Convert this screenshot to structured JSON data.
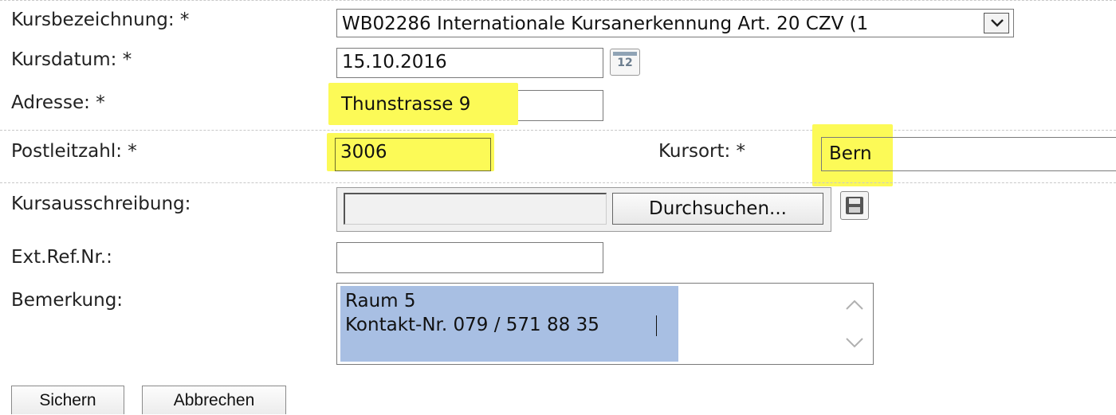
{
  "form": {
    "course_label": "Kursbezeichnung: *",
    "course_value": "WB02286 Internationale Kursanerkennung Art. 20 CZV (1",
    "date_label": "Kursdatum: *",
    "date_value": "15.10.2016",
    "calendar_icon_text": "12",
    "address_label": "Adresse: *",
    "address_value": "Thunstrasse 9",
    "zip_label": "Postleitzahl: *",
    "zip_value": "3006",
    "place_label": "Kursort: *",
    "place_value": "Bern",
    "announcement_label": "Kursausschreibung:",
    "browse_label": "Durchsuchen...",
    "extref_label": "Ext.Ref.Nr.:",
    "extref_value": "",
    "remark_label": "Bemerkung:",
    "remark_lines": [
      "Raum 5",
      "Kontakt-Nr. 079 / 571 88 35"
    ]
  },
  "buttons": {
    "save": "Sichern",
    "cancel": "Abbrechen"
  },
  "icons": {
    "select_arrow": "chevron-down-icon",
    "calendar": "calendar-icon",
    "save_disk": "floppy-disk-icon",
    "scroll_up": "chevron-up-icon",
    "scroll_down": "chevron-down-icon"
  },
  "colors": {
    "highlight": "#fcfa57",
    "selection": "#a8bfe3",
    "separator": "#c8c8c8"
  }
}
